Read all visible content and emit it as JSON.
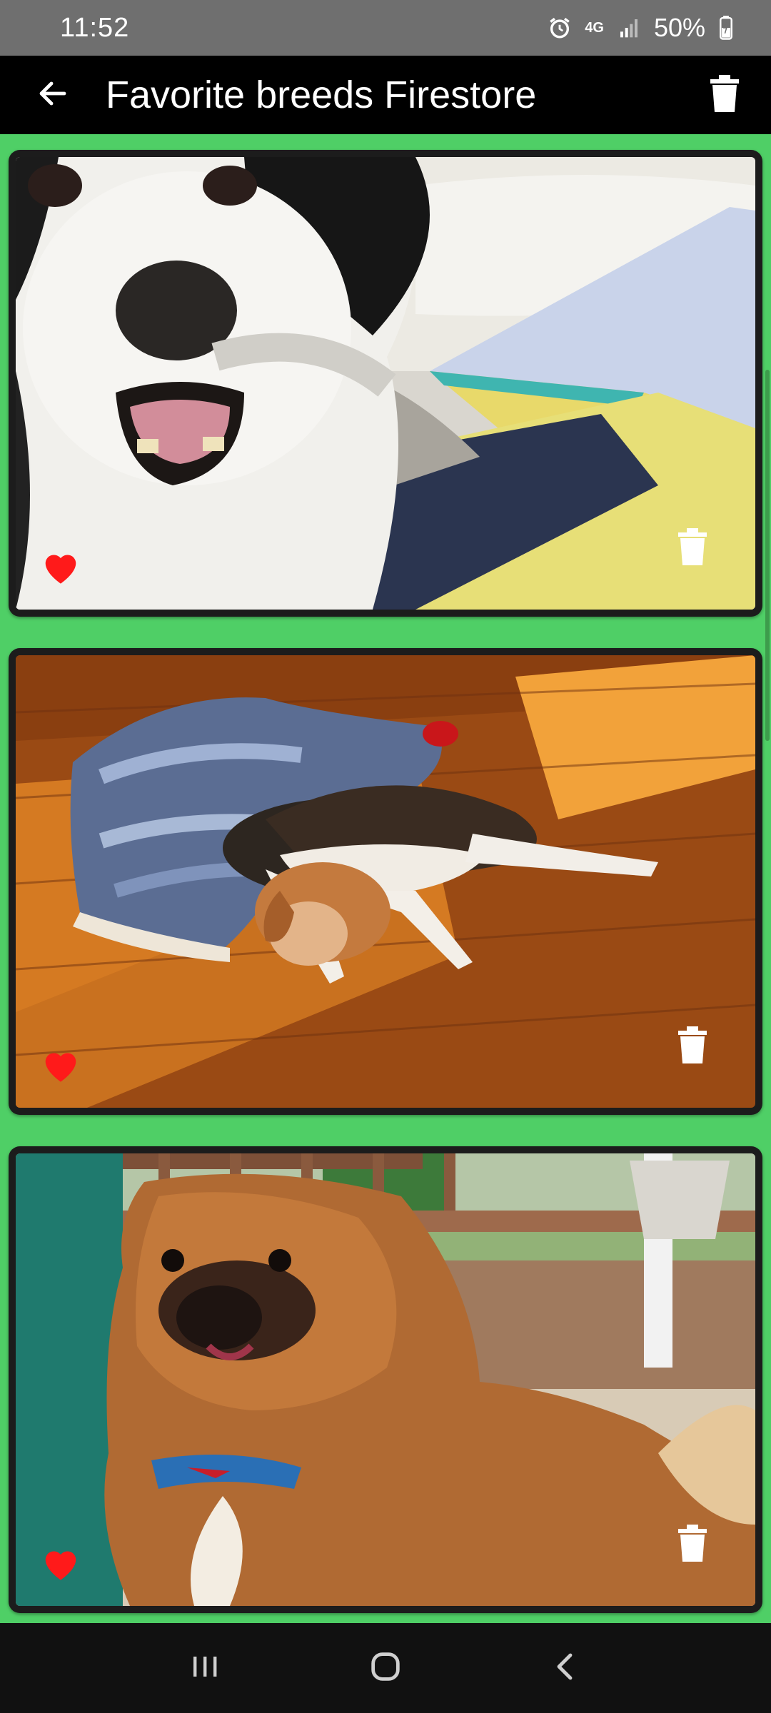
{
  "status_bar": {
    "time": "11:52",
    "network": "4G",
    "battery": "50%"
  },
  "app_bar": {
    "title": "Favorite breeds Firestore",
    "back_icon": "arrow-back-icon",
    "delete_icon": "trash-icon"
  },
  "colors": {
    "background": "#4fcf66",
    "app_bar": "#000000",
    "status_bar": "#6f6f6f",
    "card": "#1c1c1c",
    "favorite": "#ff1a1a"
  },
  "favorites": [
    {
      "scene": "border-collie-on-bed",
      "favorite_icon": "heart-icon",
      "delete_icon": "trash-icon",
      "is_favorite": true
    },
    {
      "scene": "beagle-on-wood-floor",
      "favorite_icon": "heart-icon",
      "delete_icon": "trash-icon",
      "is_favorite": true
    },
    {
      "scene": "pekingese-by-window",
      "favorite_icon": "heart-icon",
      "delete_icon": "trash-icon",
      "is_favorite": true
    }
  ],
  "nav_bar": {
    "recents_icon": "recents-icon",
    "home_icon": "home-icon",
    "back_icon": "nav-back-icon"
  }
}
